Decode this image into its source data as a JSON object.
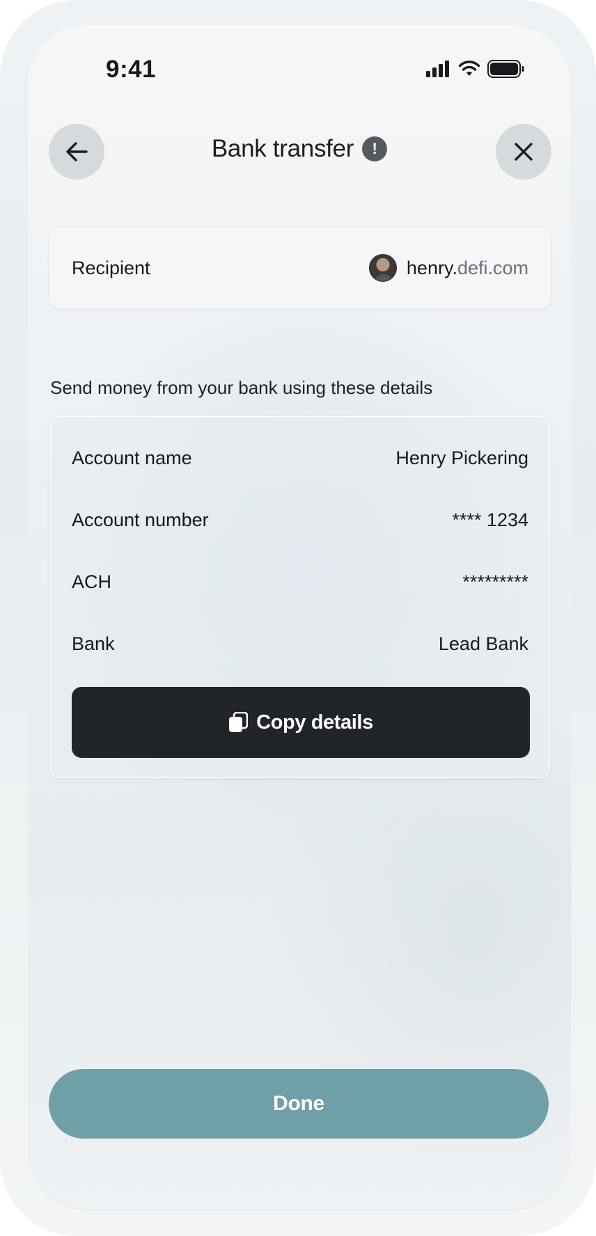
{
  "status_bar": {
    "time": "9:41",
    "icons": [
      "signal-icon",
      "wifi-icon",
      "battery-icon"
    ]
  },
  "header": {
    "title": "Bank transfer",
    "info_icon_glyph": "!",
    "back_icon": "arrow-left-icon",
    "close_icon": "close-icon"
  },
  "recipient": {
    "label": "Recipient",
    "handle_user": "henry.",
    "handle_domain": "defi.com"
  },
  "instruction": "Send money from your bank using these details",
  "details": {
    "rows": [
      {
        "label": "Account name",
        "value": "Henry Pickering"
      },
      {
        "label": "Account number",
        "value": "**** 1234"
      },
      {
        "label": "ACH",
        "value": "*********"
      },
      {
        "label": "Bank",
        "value": "Lead Bank"
      }
    ],
    "copy_label": "Copy details",
    "copy_icon": "copy-icon"
  },
  "done_label": "Done",
  "colors": {
    "primary_dark": "#212428",
    "done_button": "#6fa0a8",
    "nav_button": "#d6dadd",
    "domain_text": "#6c7178"
  }
}
